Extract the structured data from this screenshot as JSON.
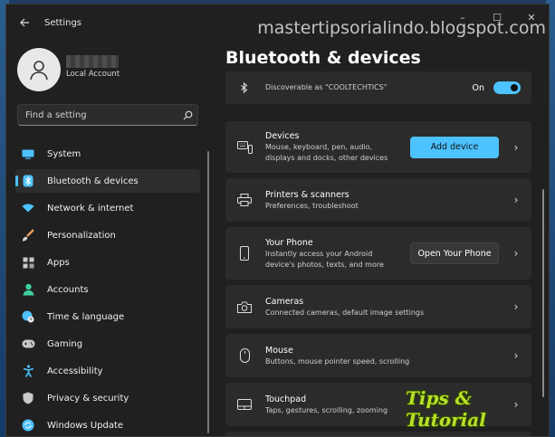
{
  "window": {
    "title": "Settings",
    "controls": {
      "minimize": "–",
      "maximize": "☐",
      "close": "✕"
    }
  },
  "watermark": "mastertipsorialindo.blogspot.com",
  "logo_text": "Tips & Tutorial",
  "account": {
    "type": "Local Account"
  },
  "search": {
    "placeholder": "Find a setting"
  },
  "nav": [
    {
      "label": "System",
      "icon": "monitor-icon",
      "color": "#4cc2ff"
    },
    {
      "label": "Bluetooth & devices",
      "icon": "bluetooth-icon",
      "color": "#4cc2ff",
      "active": true
    },
    {
      "label": "Network & internet",
      "icon": "wifi-icon",
      "color": "#4cc2ff"
    },
    {
      "label": "Personalization",
      "icon": "brush-icon",
      "color": "#e8a060"
    },
    {
      "label": "Apps",
      "icon": "apps-icon",
      "color": "#c9c9c9"
    },
    {
      "label": "Accounts",
      "icon": "person-icon",
      "color": "#3fd0a0"
    },
    {
      "label": "Time & language",
      "icon": "globe-clock-icon",
      "color": "#4cc2ff"
    },
    {
      "label": "Gaming",
      "icon": "gamepad-icon",
      "color": "#c9c9c9"
    },
    {
      "label": "Accessibility",
      "icon": "accessibility-icon",
      "color": "#4cc2ff"
    },
    {
      "label": "Privacy & security",
      "icon": "shield-icon",
      "color": "#c9c9c9"
    },
    {
      "label": "Windows Update",
      "icon": "update-icon",
      "color": "#4cc2ff"
    }
  ],
  "page": {
    "title": "Bluetooth & devices"
  },
  "bluetooth_card": {
    "subtitle": "Discoverable as \"COOLTECHTICS\"",
    "toggle_label": "On",
    "toggle_on": true
  },
  "cards": [
    {
      "title": "Devices",
      "subtitle": "Mouse, keyboard, pen, audio, displays and docks, other devices",
      "button": "Add device",
      "button_style": "accent",
      "icon": "devices-icon"
    },
    {
      "title": "Printers & scanners",
      "subtitle": "Preferences, troubleshoot",
      "icon": "printer-icon"
    },
    {
      "title": "Your Phone",
      "subtitle": "Instantly access your Android device's photos, texts, and more",
      "button": "Open Your Phone",
      "button_style": "plain",
      "icon": "phone-icon"
    },
    {
      "title": "Cameras",
      "subtitle": "Connected cameras, default image settings",
      "icon": "camera-icon"
    },
    {
      "title": "Mouse",
      "subtitle": "Buttons, mouse pointer speed, scrolling",
      "icon": "mouse-icon"
    },
    {
      "title": "Touchpad",
      "subtitle": "Taps, gestures, scrolling, zooming",
      "icon": "touchpad-icon"
    }
  ],
  "chevron": "›"
}
